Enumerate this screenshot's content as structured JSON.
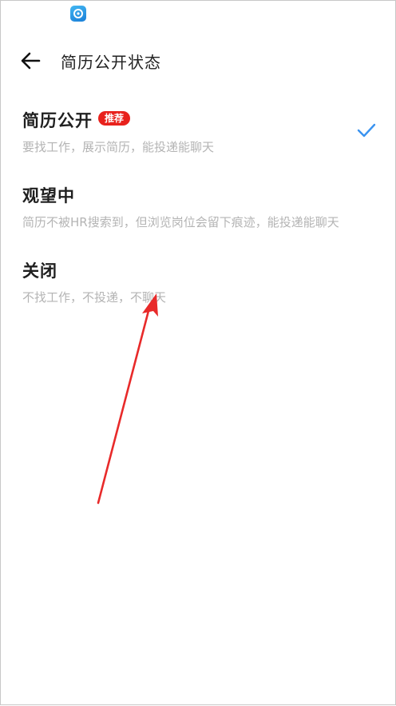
{
  "header": {
    "title": "简历公开状态"
  },
  "icons": {
    "back": "arrow-left-icon",
    "check": "check-icon",
    "app": "app-logo-icon"
  },
  "colors": {
    "accent": "#3a93f0",
    "badge": "#e8211c",
    "annotation_arrow": "#e82a2a"
  },
  "options": [
    {
      "title": "简历公开",
      "badge": "推荐",
      "desc": "要找工作，展示简历，能投递能聊天",
      "selected": true
    },
    {
      "title": "观望中",
      "desc": "简历不被HR搜索到，但浏览岗位会留下痕迹，能投递能聊天",
      "selected": false
    },
    {
      "title": "关闭",
      "desc": "不找工作，不投递，不聊天",
      "selected": false
    }
  ]
}
